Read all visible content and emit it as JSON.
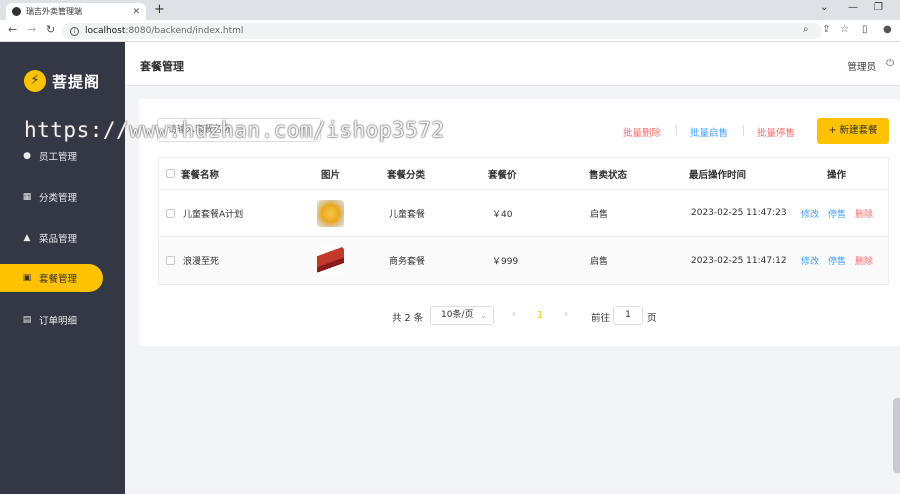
{
  "browser": {
    "tab_title": "瑞吉外卖管理端",
    "url_host": "localhost",
    "url_path": ":8080/backend/index.html"
  },
  "sidebar": {
    "logo_text": "菩提阁",
    "items": [
      {
        "label": "员工管理",
        "icon": "info-icon"
      },
      {
        "label": "分类管理",
        "icon": "grid-icon"
      },
      {
        "label": "菜品管理",
        "icon": "dish-icon"
      },
      {
        "label": "套餐管理",
        "icon": "gift-icon",
        "active": true
      },
      {
        "label": "订单明细",
        "icon": "clipboard-icon"
      }
    ]
  },
  "header": {
    "title": "套餐管理",
    "user": "管理员"
  },
  "toolbar": {
    "search_placeholder": "请输入套餐名称",
    "batch_delete": "批量删除",
    "batch_enable": "批量启售",
    "batch_disable": "批量停售",
    "add_button": "+ 新建套餐"
  },
  "table": {
    "headers": [
      "套餐名称",
      "图片",
      "套餐分类",
      "套餐价",
      "售卖状态",
      "最后操作时间",
      "操作"
    ],
    "rows": [
      {
        "name": "儿童套餐A计划",
        "category": "儿童套餐",
        "price": "￥40",
        "status": "启售",
        "updated": "2023-02-25 11:47:23",
        "ops": [
          "修改",
          "停售",
          "删除"
        ]
      },
      {
        "name": "浪漫至死",
        "category": "商务套餐",
        "price": "￥999",
        "status": "启售",
        "updated": "2023-02-25 11:47:12",
        "ops": [
          "修改",
          "停售",
          "删除"
        ]
      }
    ]
  },
  "pagination": {
    "total": "共 2 条",
    "page_size": "10条/页",
    "current_page": "1",
    "goto_label": "前往",
    "goto_value": "1",
    "page_suffix": "页"
  },
  "watermark": "https://www.huzhan.com/ishop3572",
  "colors": {
    "accent": "#ffc200",
    "sidebar": "#343744",
    "link_blue": "#419eff",
    "danger": "#f56c6c"
  }
}
